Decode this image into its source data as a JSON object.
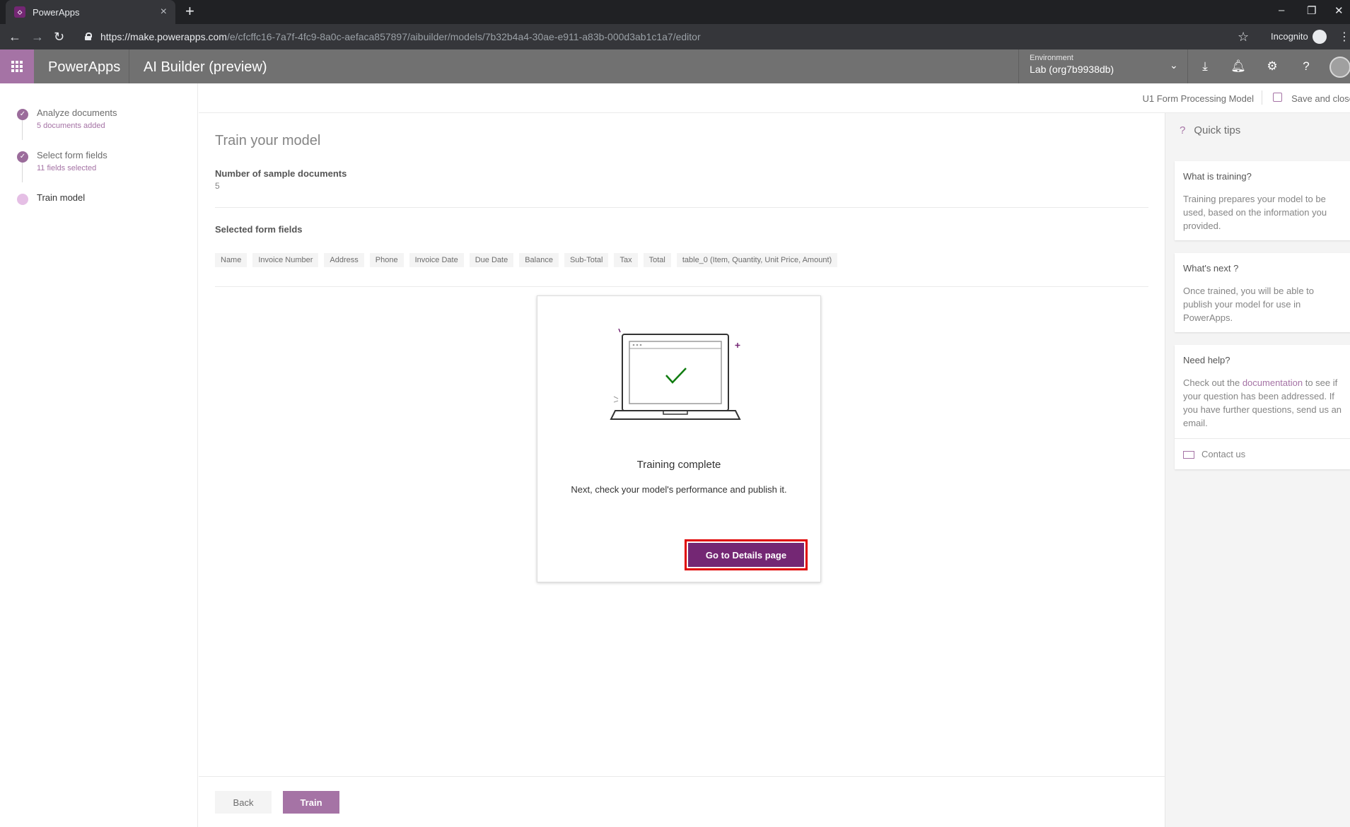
{
  "browser": {
    "tab_title": "PowerApps",
    "tab_close": "×",
    "new_tab": "+",
    "url_host": "https://make.powerapps.com",
    "url_path": "/e/cfcffc16-7a7f-4fc9-8a0c-aefaca857897/aibuilder/models/7b32b4a4-30ae-e911-a83b-000d3ab1c1a7/editor",
    "incognito_label": "Incognito"
  },
  "app": {
    "name": "PowerApps",
    "subtitle": "AI Builder (preview)",
    "environment_label": "Environment",
    "environment_value": "Lab (org7b9938db)"
  },
  "steps": [
    {
      "title": "Analyze documents",
      "subtitle": "5 documents added",
      "state": "done"
    },
    {
      "title": "Select form fields",
      "subtitle": "11 fields selected",
      "state": "done"
    },
    {
      "title": "Train model",
      "subtitle": "",
      "state": "current"
    }
  ],
  "modelbar": {
    "model_name": "U1 Form Processing Model",
    "save_label": "Save and close"
  },
  "main": {
    "title": "Train your model",
    "num_docs_label": "Number of sample documents",
    "num_docs_value": "5",
    "fields_label": "Selected form fields",
    "fields": [
      "Name",
      "Invoice Number",
      "Address",
      "Phone",
      "Invoice Date",
      "Due Date",
      "Balance",
      "Sub-Total",
      "Tax",
      "Total",
      "table_0 (Item, Quantity, Unit Price, Amount)"
    ],
    "card_title": "Training complete",
    "card_subtitle": "Next, check your model's performance and publish it.",
    "details_button": "Go to Details page",
    "back_button": "Back",
    "train_button": "Train"
  },
  "tips": {
    "heading": "Quick tips",
    "cards": [
      {
        "title": "What is training?",
        "text": "Training prepares your model to be used, based on the information you provided."
      },
      {
        "title": "What's next ?",
        "text": "Once trained, you will be able to publish your model for use in PowerApps."
      },
      {
        "title": "Need help?",
        "text_before": "Check out the ",
        "link": "documentation",
        "text_after": " to see if your question has been addressed. If you have further questions, send us an email.",
        "contact": "Contact us"
      }
    ]
  },
  "colors": {
    "brand": "#742774",
    "brand_light": "#a573a5",
    "header_gray": "#717171",
    "highlight_red": "#e00000"
  }
}
